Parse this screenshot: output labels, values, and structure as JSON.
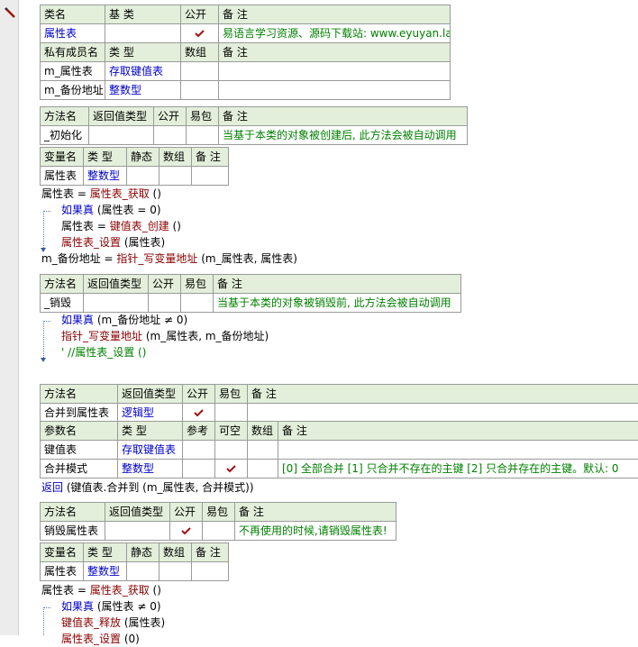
{
  "class_table": {
    "headers": [
      "类名",
      "基 类",
      "公开",
      "备 注"
    ],
    "row": {
      "name": "属性表",
      "base": "",
      "public": true,
      "note": "易语言学习资源、源码下载站: www.eyuyan.la"
    }
  },
  "members_table": {
    "headers": [
      "私有成员名",
      "类 型",
      "数组",
      "备 注"
    ],
    "rows": [
      {
        "name": "m_属性表",
        "type": "存取键值表",
        "array": "",
        "note": ""
      },
      {
        "name": "m_备份地址",
        "type": "整数型",
        "array": "",
        "note": ""
      }
    ]
  },
  "method_init": {
    "headers": [
      "方法名",
      "返回值类型",
      "公开",
      "易包",
      "备 注"
    ],
    "row": {
      "name": "_初始化",
      "ret": "",
      "public": "",
      "epkg": "",
      "note": "当基于本类的对象被创建后, 此方法会被自动调用"
    }
  },
  "vars_init": {
    "headers": [
      "变量名",
      "类 型",
      "静态",
      "数组",
      "备 注"
    ],
    "row": {
      "name": "属性表",
      "type": "整数型",
      "static": "",
      "array": "",
      "note": ""
    }
  },
  "code_init": {
    "line1": {
      "a": "属性表",
      "op": " = ",
      "fn": "属性表_获取",
      "args": " ()"
    },
    "line2": {
      "kw": "如果真",
      "args": " (属性表 = 0)"
    },
    "line3": {
      "a": "属性表",
      "op": " = ",
      "fn": "键值表_创建",
      "args": " ()"
    },
    "line4": {
      "fn": "属性表_设置",
      "args": " (属性表)"
    },
    "line5": {
      "a": "m_备份地址",
      "op": " = ",
      "fn": "指针_写变量地址",
      "args": " (m_属性表, 属性表)"
    }
  },
  "method_destroy": {
    "headers": [
      "方法名",
      "返回值类型",
      "公开",
      "易包",
      "备 注"
    ],
    "row": {
      "name": "_销毁",
      "ret": "",
      "public": "",
      "epkg": "",
      "note": "当基于本类的对象被销毁前, 此方法会被自动调用"
    }
  },
  "code_destroy": {
    "line1": {
      "kw": "如果真",
      "args": " (m_备份地址 ≠ 0)"
    },
    "line2": {
      "fn": "指针_写变量地址",
      "args": " (m_属性表, m_备份地址)"
    },
    "line3": {
      "cmt": "' //属性表_设置 ()"
    }
  },
  "method_merge": {
    "headers": [
      "方法名",
      "返回值类型",
      "公开",
      "易包",
      "备 注"
    ],
    "row": {
      "name": "合并到属性表",
      "ret": "逻辑型",
      "public": true,
      "epkg": "",
      "note": ""
    }
  },
  "params_merge": {
    "headers": [
      "参数名",
      "类 型",
      "参考",
      "可空",
      "数组",
      "备 注"
    ],
    "rows": [
      {
        "name": "键值表",
        "type": "存取键值表",
        "ref": "",
        "nullable": false,
        "array": "",
        "note": ""
      },
      {
        "name": "合并模式",
        "type": "整数型",
        "ref": "",
        "nullable": true,
        "array": "",
        "note": "[0] 全部合并 [1] 只合并不存在的主键 [2] 只合并存在的主键。默认: 0"
      }
    ]
  },
  "code_merge": {
    "line1": {
      "kw": "返回",
      "args": " (键值表.合并到 (m_属性表, 合并模式))"
    }
  },
  "method_release": {
    "headers": [
      "方法名",
      "返回值类型",
      "公开",
      "易包",
      "备 注"
    ],
    "row": {
      "name": "销毁属性表",
      "ret": "",
      "public": true,
      "epkg": "",
      "note": "不再使用的时候,请销毁属性表!"
    }
  },
  "vars_release": {
    "headers": [
      "变量名",
      "类 型",
      "静态",
      "数组",
      "备 注"
    ],
    "row": {
      "name": "属性表",
      "type": "整数型",
      "static": "",
      "array": "",
      "note": ""
    }
  },
  "code_release": {
    "line1": {
      "a": "属性表",
      "op": " = ",
      "fn": "属性表_获取",
      "args": " ()"
    },
    "line2": {
      "kw": "如果真",
      "args": " (属性表 ≠ 0)"
    },
    "line3": {
      "fn": "键值表_释放",
      "args": " (属性表)"
    },
    "line4": {
      "fn": "属性表_设置",
      "args": " (0)"
    }
  },
  "icons": {
    "gutter": "pen-icon",
    "check": "check-icon"
  },
  "colors": {
    "header_bg": "#e3efda",
    "keyword": "#0000c8",
    "function": "#8b0000",
    "comment": "#008000",
    "grid": "#9a9a9a"
  }
}
